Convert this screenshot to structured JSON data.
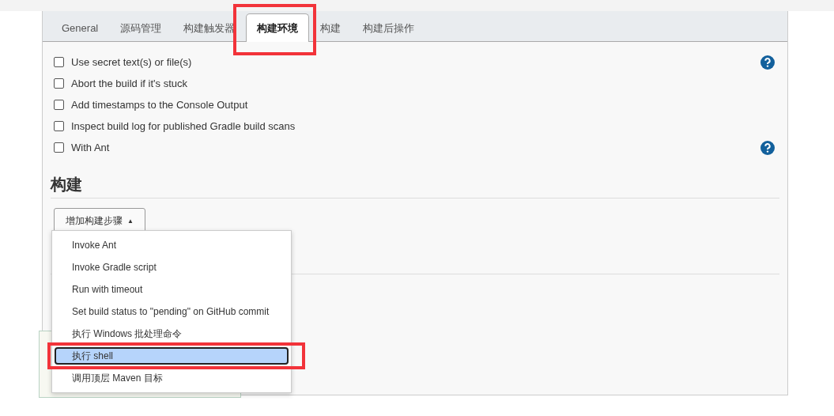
{
  "tabs": [
    {
      "label": "General",
      "selected": false,
      "annotated": false
    },
    {
      "label": "源码管理",
      "selected": false,
      "annotated": false
    },
    {
      "label": "构建触发器",
      "selected": false,
      "annotated": false
    },
    {
      "label": "构建环境",
      "selected": true,
      "annotated": true
    },
    {
      "label": "构建",
      "selected": false,
      "annotated": false
    },
    {
      "label": "构建后操作",
      "selected": false,
      "annotated": false
    }
  ],
  "options": [
    {
      "label": "Use secret text(s) or file(s)",
      "checked": false,
      "help": true
    },
    {
      "label": "Abort the build if it's stuck",
      "checked": false,
      "help": false
    },
    {
      "label": "Add timestamps to the Console Output",
      "checked": false,
      "help": false
    },
    {
      "label": "Inspect build log for published Gradle build scans",
      "checked": false,
      "help": false
    },
    {
      "label": "With Ant",
      "checked": false,
      "help": true
    }
  ],
  "section": {
    "title": "构建",
    "add_button": "增加构建步骤",
    "caret": "▲"
  },
  "menu": [
    {
      "label": "Invoke Ant",
      "selected": false,
      "annotated": false
    },
    {
      "label": "Invoke Gradle script",
      "selected": false,
      "annotated": false
    },
    {
      "label": "Run with timeout",
      "selected": false,
      "annotated": false
    },
    {
      "label": "Set build status to \"pending\" on GitHub commit",
      "selected": false,
      "annotated": false
    },
    {
      "label": "执行 Windows 批处理命令",
      "selected": false,
      "annotated": false
    },
    {
      "label": "执行 shell",
      "selected": true,
      "annotated": true
    },
    {
      "label": "调用顶层 Maven 目标",
      "selected": false,
      "annotated": false
    }
  ]
}
